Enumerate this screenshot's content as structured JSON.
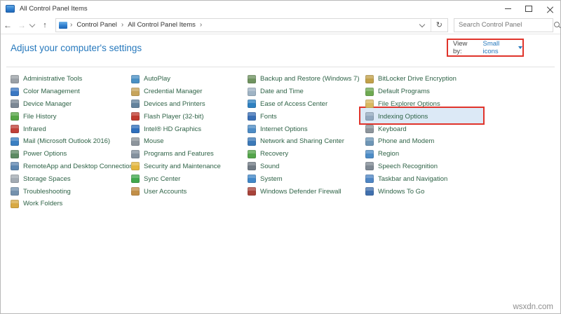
{
  "window": {
    "title": "All Control Panel Items"
  },
  "navbar": {
    "breadcrumb": [
      "Control Panel",
      "All Control Panel Items"
    ],
    "search_placeholder": "Search Control Panel"
  },
  "header": {
    "title": "Adjust your computer's settings",
    "view_by_label": "View by:",
    "view_by_value": "Small icons"
  },
  "highlight": {
    "color": "#e0342b",
    "highlighted_item": "Indexing Options",
    "highlight_fill": "#dce9f6"
  },
  "items_columns": [
    [
      {
        "label": "Administrative Tools",
        "icon": "admin-tools-icon",
        "color": "#9aa0a6"
      },
      {
        "label": "Color Management",
        "icon": "color-management-icon",
        "color": "#3b78c3"
      },
      {
        "label": "Device Manager",
        "icon": "device-manager-icon",
        "color": "#7b8794"
      },
      {
        "label": "File History",
        "icon": "file-history-icon",
        "color": "#55a546"
      },
      {
        "label": "Infrared",
        "icon": "infrared-icon",
        "color": "#c04038"
      },
      {
        "label": "Mail (Microsoft Outlook 2016)",
        "icon": "mail-icon",
        "color": "#3a7fc2"
      },
      {
        "label": "Power Options",
        "icon": "power-options-icon",
        "color": "#5d8a63"
      },
      {
        "label": "RemoteApp and Desktop Connections",
        "icon": "remoteapp-icon",
        "color": "#5b85b0"
      },
      {
        "label": "Storage Spaces",
        "icon": "storage-spaces-icon",
        "color": "#a3abb3"
      },
      {
        "label": "Troubleshooting",
        "icon": "troubleshooting-icon",
        "color": "#7491ad"
      },
      {
        "label": "Work Folders",
        "icon": "work-folders-icon",
        "color": "#d8a944"
      }
    ],
    [
      {
        "label": "AutoPlay",
        "icon": "autoplay-icon",
        "color": "#4a90c4"
      },
      {
        "label": "Credential Manager",
        "icon": "credential-manager-icon",
        "color": "#c7a45c"
      },
      {
        "label": "Devices and Printers",
        "icon": "devices-printers-icon",
        "color": "#64839d"
      },
      {
        "label": "Flash Player (32-bit)",
        "icon": "flash-player-icon",
        "color": "#bf3a2f"
      },
      {
        "label": "Intel® HD Graphics",
        "icon": "intel-hd-graphics-icon",
        "color": "#2f6fbc"
      },
      {
        "label": "Mouse",
        "icon": "mouse-icon",
        "color": "#8d959c"
      },
      {
        "label": "Programs and Features",
        "icon": "programs-features-icon",
        "color": "#84919e"
      },
      {
        "label": "Security and Maintenance",
        "icon": "security-maintenance-icon",
        "color": "#e3b63e"
      },
      {
        "label": "Sync Center",
        "icon": "sync-center-icon",
        "color": "#41a84d"
      },
      {
        "label": "User Accounts",
        "icon": "user-accounts-icon",
        "color": "#c28f48"
      }
    ],
    [
      {
        "label": "Backup and Restore (Windows 7)",
        "icon": "backup-restore-icon",
        "color": "#6f9360"
      },
      {
        "label": "Date and Time",
        "icon": "date-time-icon",
        "color": "#9fb3c4"
      },
      {
        "label": "Ease of Access Center",
        "icon": "ease-of-access-icon",
        "color": "#2f80c0"
      },
      {
        "label": "Fonts",
        "icon": "fonts-icon",
        "color": "#3a6fb5"
      },
      {
        "label": "Internet Options",
        "icon": "internet-options-icon",
        "color": "#4d8cc6"
      },
      {
        "label": "Network and Sharing Center",
        "icon": "network-sharing-icon",
        "color": "#3c79b8"
      },
      {
        "label": "Recovery",
        "icon": "recovery-icon",
        "color": "#54a44a"
      },
      {
        "label": "Sound",
        "icon": "sound-icon",
        "color": "#707a84"
      },
      {
        "label": "System",
        "icon": "system-icon",
        "color": "#4187c8"
      },
      {
        "label": "Windows Defender Firewall",
        "icon": "firewall-icon",
        "color": "#a8433a"
      }
    ],
    [
      {
        "label": "BitLocker Drive Encryption",
        "icon": "bitlocker-icon",
        "color": "#c2a14a"
      },
      {
        "label": "Default Programs",
        "icon": "default-programs-icon",
        "color": "#6faa52"
      },
      {
        "label": "File Explorer Options",
        "icon": "file-explorer-options-icon",
        "color": "#d9b85e"
      },
      {
        "label": "Indexing Options",
        "icon": "indexing-options-icon",
        "color": "#93a9bf",
        "highlighted": true
      },
      {
        "label": "Keyboard",
        "icon": "keyboard-icon",
        "color": "#8d959c"
      },
      {
        "label": "Phone and Modem",
        "icon": "phone-modem-icon",
        "color": "#6e96b6"
      },
      {
        "label": "Region",
        "icon": "region-icon",
        "color": "#4d8cc6"
      },
      {
        "label": "Speech Recognition",
        "icon": "speech-recognition-icon",
        "color": "#7e8893"
      },
      {
        "label": "Taskbar and Navigation",
        "icon": "taskbar-icon",
        "color": "#4f86c4"
      },
      {
        "label": "Windows To Go",
        "icon": "windows-to-go-icon",
        "color": "#4070ae"
      }
    ]
  ],
  "watermark": "wsxdn.com"
}
